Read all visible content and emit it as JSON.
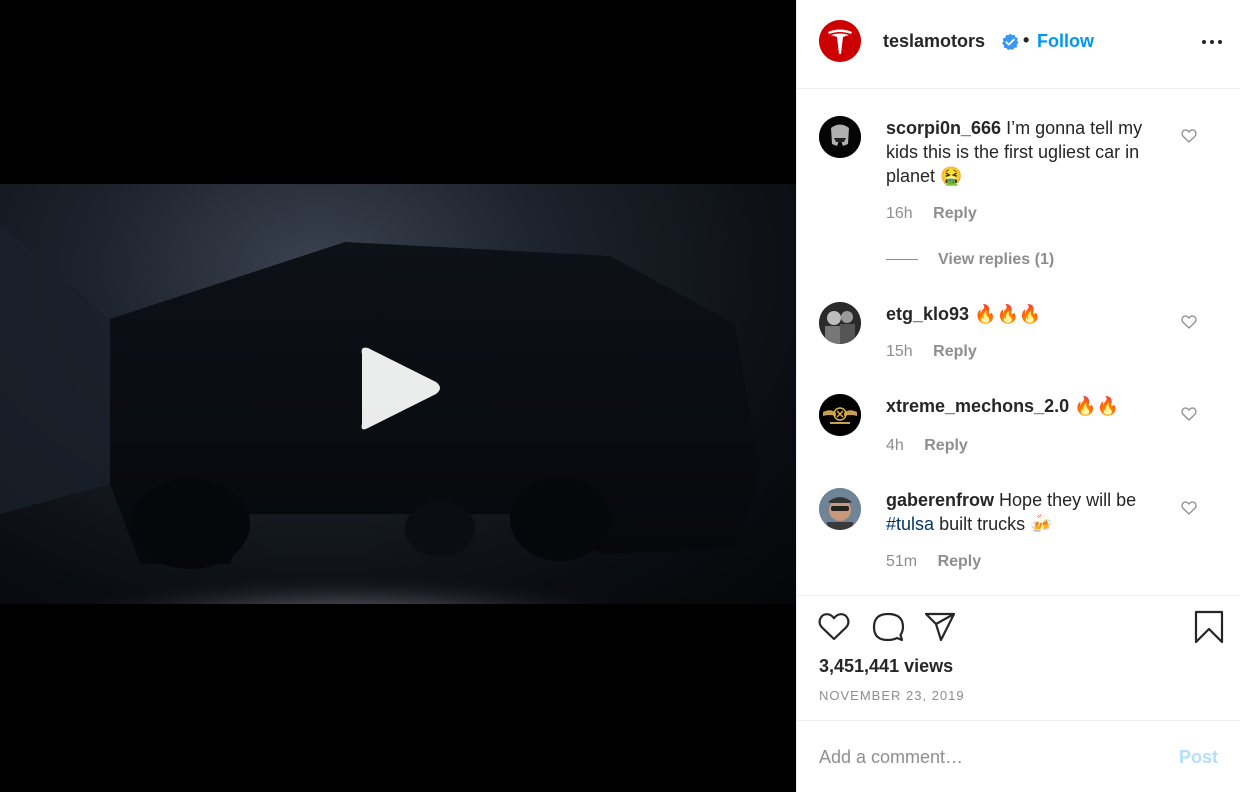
{
  "post": {
    "username": "teslamotors",
    "separator": "•",
    "follow_label": "Follow"
  },
  "comments": [
    {
      "username": "scorpi0n_666",
      "text": "I’m gonna tell my kids this is the first ugliest car in planet 🤮",
      "time": "16h",
      "reply_label": "Reply",
      "view_replies": "View replies (1)"
    },
    {
      "username": "etg_klo93",
      "text": "🔥🔥🔥",
      "time": "15h",
      "reply_label": "Reply"
    },
    {
      "username": "xtreme_mechons_2.0",
      "text": "🔥🔥",
      "time": "4h",
      "reply_label": "Reply"
    },
    {
      "username": "gaberenfrow",
      "text_before": "Hope they will be",
      "hashtag": "#tulsa",
      "text_after": "built trucks 🍻",
      "time": "51m",
      "reply_label": "Reply"
    }
  ],
  "stats": {
    "views": "3,451,441 views",
    "date": "NOVEMBER 23, 2019"
  },
  "add_comment": {
    "placeholder": "Add a comment…",
    "post_label": "Post"
  },
  "colors": {
    "accent": "#0095f6",
    "brand_red": "#cc0000",
    "muted": "#8e8e8e",
    "post_disabled": "#b2dffc"
  }
}
